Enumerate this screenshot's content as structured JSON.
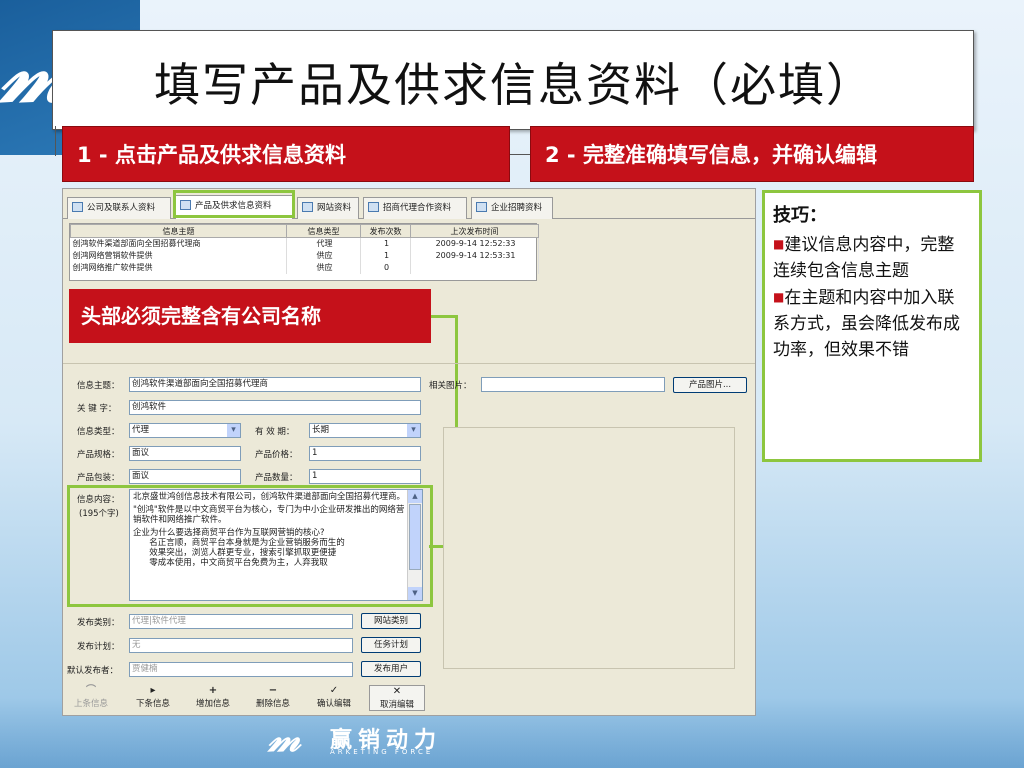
{
  "slide": {
    "title": "填写产品及供求信息资料（必填）",
    "step1": "1 - 点击产品及供求信息资料",
    "step2": "2 - 完整准确填写信息，并确认编辑",
    "callout": "头部必须完整含有公司名称",
    "accent_red": "#c5111a",
    "accent_green": "#8dc63f"
  },
  "tabs": [
    {
      "label": "公司及联系人资料",
      "icon": "company-icon"
    },
    {
      "label": "产品及供求信息资料",
      "icon": "document-icon",
      "active": true
    },
    {
      "label": "网站资料",
      "icon": "web-icon"
    },
    {
      "label": "招商代理合作资料",
      "icon": "partner-icon"
    },
    {
      "label": "企业招聘资料",
      "icon": "recruit-icon"
    }
  ],
  "grid": {
    "headers": [
      "信息主题",
      "信息类型",
      "发布次数",
      "上次发布时间"
    ],
    "rows": [
      [
        "创鸿软件渠道部面向全国招募代理商",
        "代理",
        "1",
        "2009-9-14 12:52:33"
      ],
      [
        "创鸿网络营销软件提供",
        "供应",
        "1",
        "2009-9-14 12:53:31"
      ],
      [
        "创鸿网络推广软件提供",
        "供应",
        "0",
        ""
      ]
    ]
  },
  "form": {
    "subject_label": "信息主题：",
    "subject_value": "创鸿软件渠道部面向全国招募代理商",
    "keyword_label": "关 键 字：",
    "keyword_value": "创鸿软件",
    "type_label": "信息类型：",
    "type_value": "代理",
    "validity_label": "有 效 期：",
    "validity_value": "长期",
    "spec_label": "产品规格：",
    "spec_value": "面议",
    "price_label": "产品价格：",
    "price_value": "1",
    "package_label": "产品包装：",
    "package_value": "面议",
    "quantity_label": "产品数量：",
    "quantity_value": "1",
    "picture_label": "相关图片：",
    "picture_value": "",
    "picture_button": "产品图片...",
    "content_label": "信息内容：",
    "content_count": "(195个字)",
    "content_paragraphs": [
      "北京盛世鸿创信息技术有限公司，创鸿软件渠道部面向全国招募代理商。",
      "\"创鸿\"软件是以中文商贸平台为核心，专门为中小企业研发推出的网络营销软件和网络推广软件。",
      "企业为什么要选择商贸平台作为互联网营销的核心?\n      名正言顺，商贸平台本身就是为企业营销服务而生的\n      效果突出，浏览人群更专业，搜索引擎抓取更便捷\n      零成本使用，中文商贸平台免费为主，人弃我取"
    ],
    "category_label": "发布类别：",
    "category_value": "代理|软件代理",
    "category_button": "网站类别",
    "plan_label": "发布计划：",
    "plan_value": "无",
    "plan_button": "任务计划",
    "publisher_label": "默认发布者：",
    "publisher_value": "贾健楠",
    "publisher_button": "发布用户"
  },
  "toolbar": [
    {
      "label": "上条信息",
      "glyph": "⌒",
      "enabled": false
    },
    {
      "label": "下条信息",
      "glyph": "▸",
      "enabled": true
    },
    {
      "label": "增加信息",
      "glyph": "+",
      "enabled": true
    },
    {
      "label": "删除信息",
      "glyph": "−",
      "enabled": true
    },
    {
      "label": "确认编辑",
      "glyph": "✓",
      "enabled": true
    },
    {
      "label": "取消编辑",
      "glyph": "✕",
      "enabled": true
    }
  ],
  "tips": {
    "title": "技巧：",
    "items": [
      "建议信息内容中，完整连续包含信息主题",
      "在主题和内容中加入联系方式，虽会降低发布成功率，但效果不错"
    ]
  },
  "brand": {
    "cn": "赢销动力",
    "en": "ARKETING FORCE"
  }
}
